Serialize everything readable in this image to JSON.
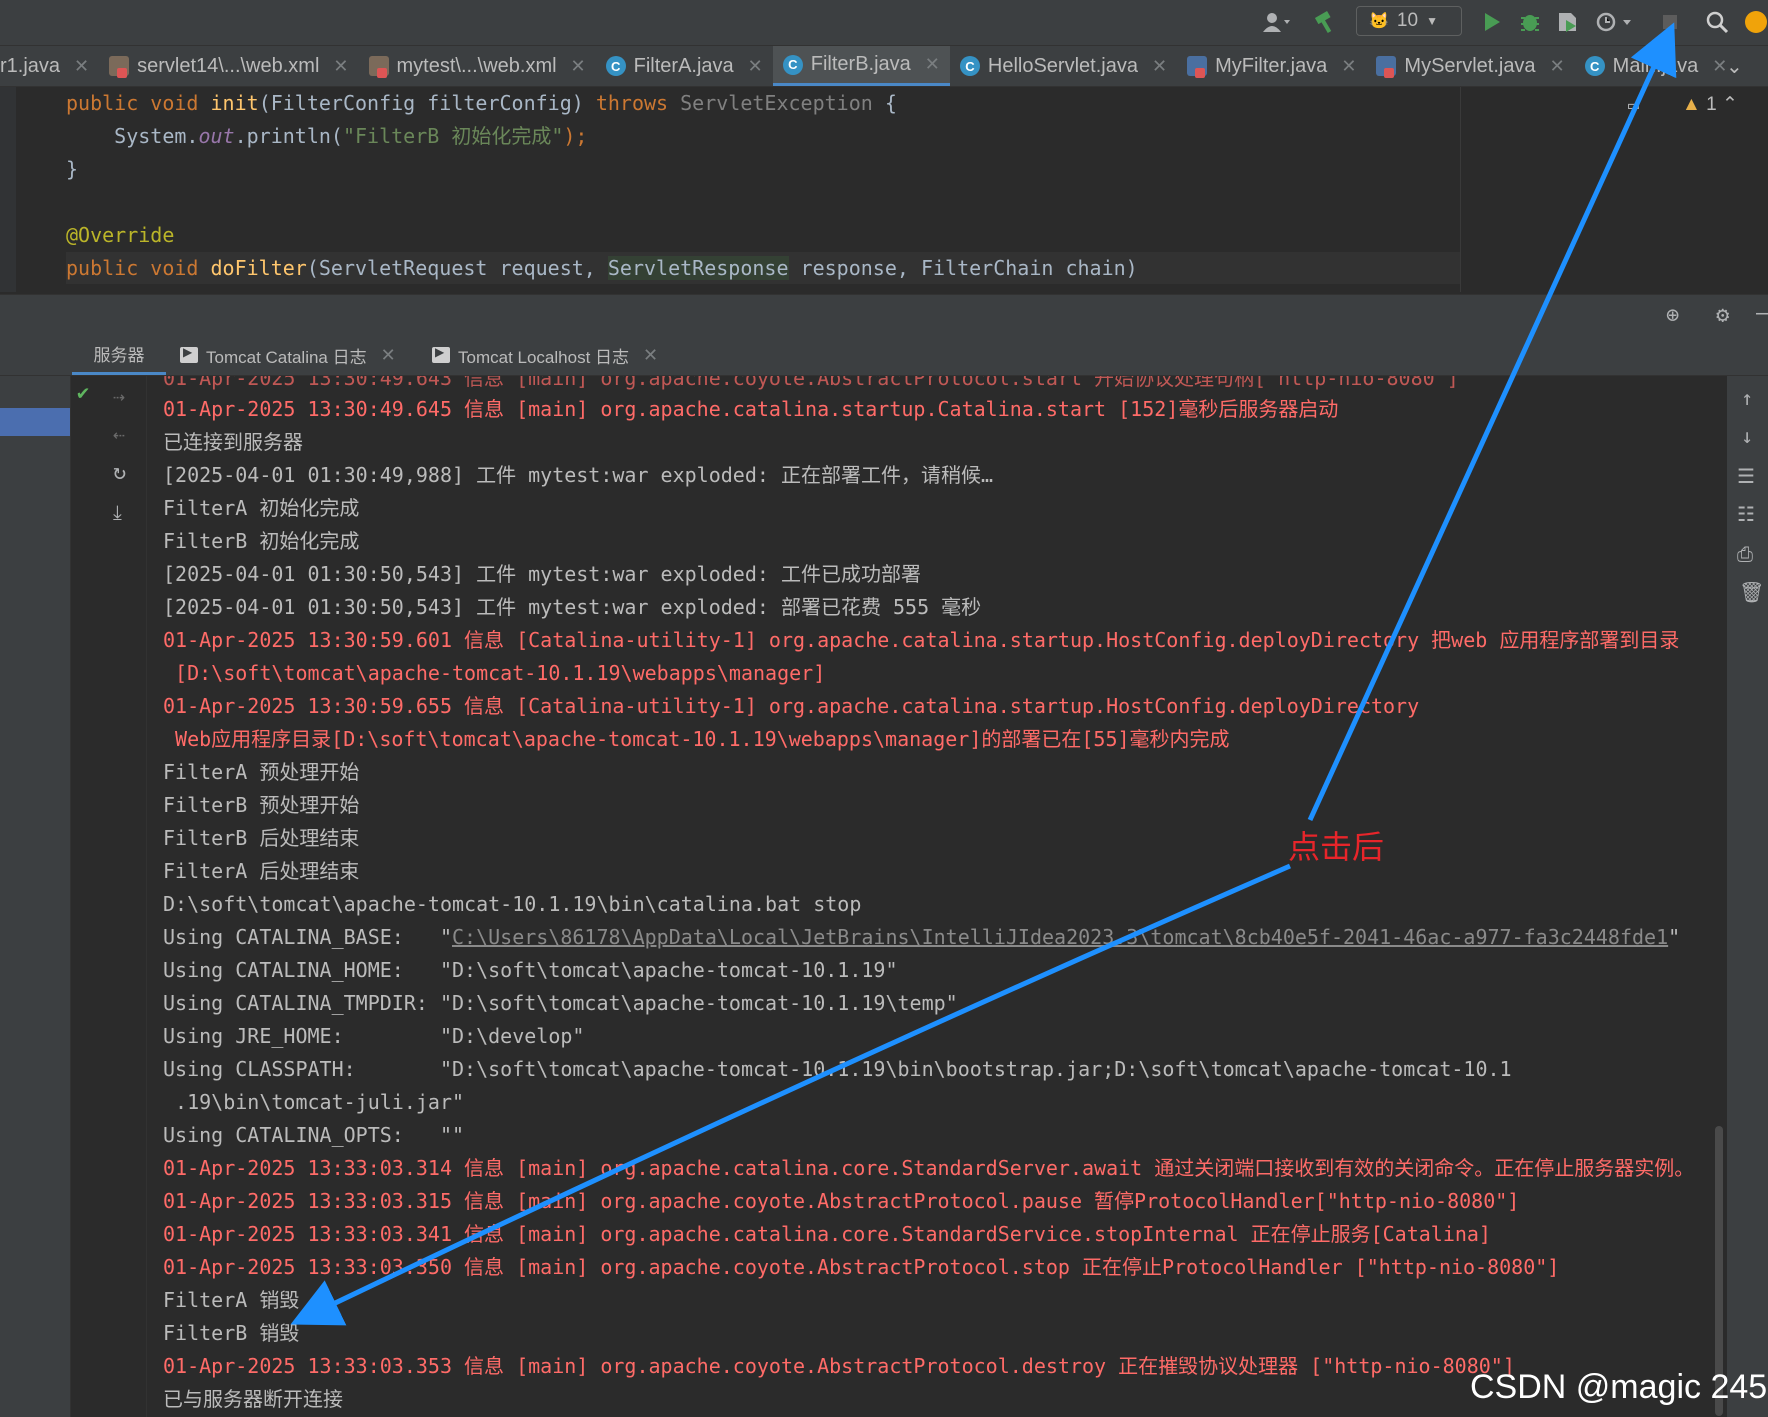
{
  "toolbar": {
    "run_config_count": "10"
  },
  "tabs": [
    {
      "label": "r1.java",
      "icon": "java-class-icon"
    },
    {
      "label": "servlet14\\...\\web.xml",
      "icon": "xml-icon"
    },
    {
      "label": "mytest\\...\\web.xml",
      "icon": "xml-icon"
    },
    {
      "label": "FilterA.java",
      "icon": "java-class-icon"
    },
    {
      "label": "FilterB.java",
      "icon": "java-class-icon",
      "active": true
    },
    {
      "label": "HelloServlet.java",
      "icon": "java-class-icon"
    },
    {
      "label": "MyFilter.java",
      "icon": "java-interface-icon"
    },
    {
      "label": "MyServlet.java",
      "icon": "java-interface-icon"
    },
    {
      "label": "Main.java",
      "icon": "java-main-icon"
    }
  ],
  "editor": {
    "warning_count": "1",
    "line1": {
      "kw1": "public",
      "kw2": "void",
      "fn": "init",
      "args": "(FilterConfig filterConfig) ",
      "throws": "throws",
      "exc": "ServletException",
      "brace": " {"
    },
    "line2": {
      "pre": "    System.",
      "out": "out",
      "call": ".println(",
      "str": "\"FilterB 初始化完成\"",
      "end": ");"
    },
    "line3": "}",
    "line5": "@Override",
    "line6": {
      "kw1": "public",
      "kw2": "void",
      "fn": "doFilter",
      "a": "(ServletRequest request, ",
      "hl": "ServletResponse",
      "b": " response, FilterChain chain)"
    }
  },
  "services": {
    "tab_services": "服务器",
    "tab_catalina": "Tomcat Catalina 日志",
    "tab_localhost": "Tomcat Localhost 日志"
  },
  "console": [
    {
      "text": "01-Apr-2025 13:30:49.645 信息 [main] org.apache.catalina.startup.Catalina.start [152]毫秒后服务器启动",
      "red": true
    },
    {
      "text": "已连接到服务器",
      "red": false
    },
    {
      "text": "[2025-04-01 01:30:49,988] 工件 mytest:war exploded: 正在部署工件，请稍候…",
      "red": false
    },
    {
      "text": "FilterA 初始化完成",
      "red": false
    },
    {
      "text": "FilterB 初始化完成",
      "red": false
    },
    {
      "text": "[2025-04-01 01:30:50,543] 工件 mytest:war exploded: 工件已成功部署",
      "red": false
    },
    {
      "text": "[2025-04-01 01:30:50,543] 工件 mytest:war exploded: 部署已花费 555 毫秒",
      "red": false
    },
    {
      "text": "01-Apr-2025 13:30:59.601 信息 [Catalina-utility-1] org.apache.catalina.startup.HostConfig.deployDirectory 把web 应用程序部署到目录",
      "red": true
    },
    {
      "text": " [D:\\soft\\tomcat\\apache-tomcat-10.1.19\\webapps\\manager]",
      "red": true
    },
    {
      "text": "01-Apr-2025 13:30:59.655 信息 [Catalina-utility-1] org.apache.catalina.startup.HostConfig.deployDirectory",
      "red": true
    },
    {
      "text": " Web应用程序目录[D:\\soft\\tomcat\\apache-tomcat-10.1.19\\webapps\\manager]的部署已在[55]毫秒内完成",
      "red": true
    },
    {
      "text": "FilterA 预处理开始",
      "red": false
    },
    {
      "text": "FilterB 预处理开始",
      "red": false
    },
    {
      "text": "FilterB 后处理结束",
      "red": false
    },
    {
      "text": "FilterA 后处理结束",
      "red": false
    },
    {
      "text": "D:\\soft\\tomcat\\apache-tomcat-10.1.19\\bin\\catalina.bat stop",
      "red": false
    },
    {
      "text": "Using CATALINA_BASE:   \"",
      "link": "C:\\Users\\86178\\AppData\\Local\\JetBrains\\IntelliJIdea2023.3\\tomcat\\8cb40e5f-2041-46ac-a977-fa3c2448fde1",
      "tail": "\"",
      "red": false
    },
    {
      "text": "Using CATALINA_HOME:   \"D:\\soft\\tomcat\\apache-tomcat-10.1.19\"",
      "red": false
    },
    {
      "text": "Using CATALINA_TMPDIR: \"D:\\soft\\tomcat\\apache-tomcat-10.1.19\\temp\"",
      "red": false
    },
    {
      "text": "Using JRE_HOME:        \"D:\\develop\"",
      "red": false
    },
    {
      "text": "Using CLASSPATH:       \"D:\\soft\\tomcat\\apache-tomcat-10.1.19\\bin\\bootstrap.jar;D:\\soft\\tomcat\\apache-tomcat-10.1",
      "red": false
    },
    {
      "text": " .19\\bin\\tomcat-juli.jar\"",
      "red": false
    },
    {
      "text": "Using CATALINA_OPTS:   \"\"",
      "red": false
    },
    {
      "text": "01-Apr-2025 13:33:03.314 信息 [main] org.apache.catalina.core.StandardServer.await 通过关闭端口接收到有效的关闭命令。正在停止服务器实例。",
      "red": true
    },
    {
      "text": "01-Apr-2025 13:33:03.315 信息 [main] org.apache.coyote.AbstractProtocol.pause 暂停ProtocolHandler[\"http-nio-8080\"]",
      "red": true
    },
    {
      "text": "01-Apr-2025 13:33:03.341 信息 [main] org.apache.catalina.core.StandardService.stopInternal 正在停止服务[Catalina]",
      "red": true
    },
    {
      "text": "01-Apr-2025 13:33:03.350 信息 [main] org.apache.coyote.AbstractProtocol.stop 正在停止ProtocolHandler [\"http-nio-8080\"]",
      "red": true
    },
    {
      "text": "FilterA 销毁",
      "red": false
    },
    {
      "text": "FilterB 销毁",
      "red": false
    },
    {
      "text": "01-Apr-2025 13:33:03.353 信息 [main] org.apache.coyote.AbstractProtocol.destroy 正在摧毁协议处理器 [\"http-nio-8080\"]",
      "red": true
    },
    {
      "text": "已与服务器断开连接",
      "red": false
    }
  ],
  "annotation": "点击后",
  "watermark": "CSDN @magic 245",
  "colors": {
    "arrow": "#1e90ff",
    "annotation": "#e8252a",
    "console_red": "#ff6b68",
    "tab_active_underline": "#4a88c7"
  }
}
